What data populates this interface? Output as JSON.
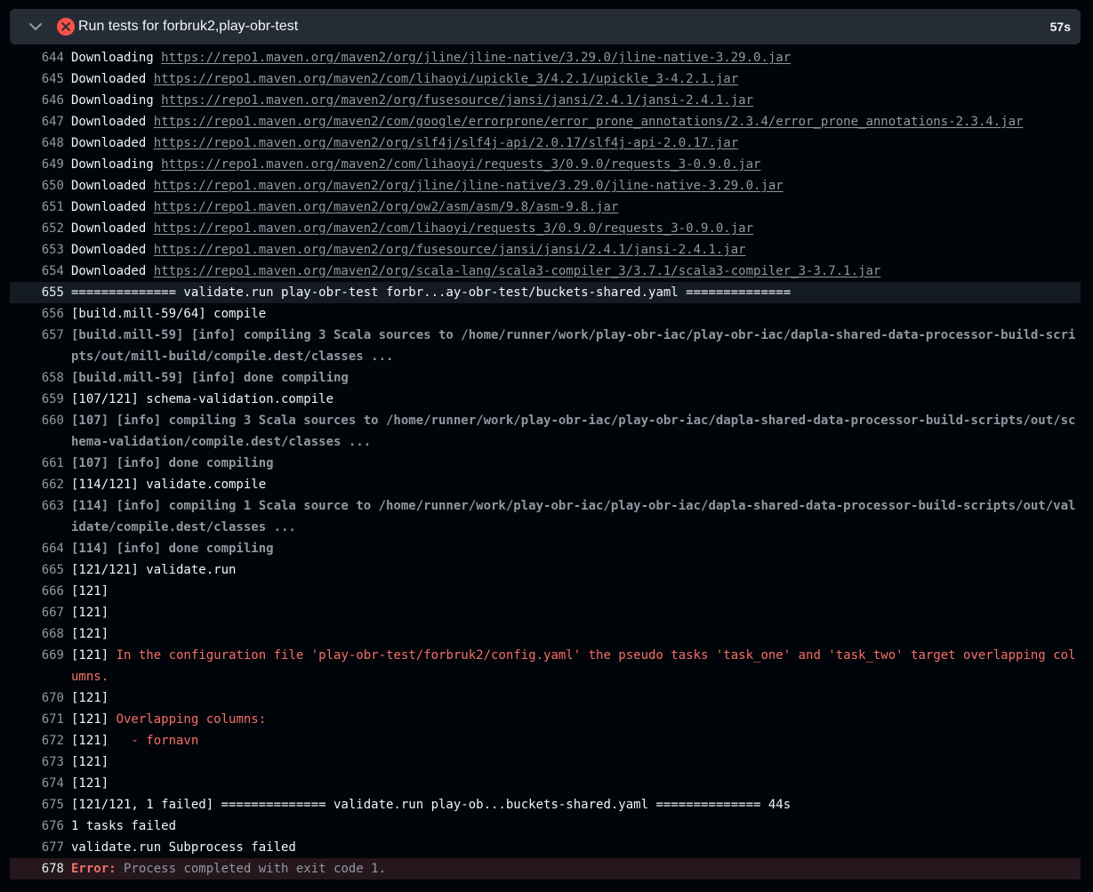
{
  "step": {
    "title": "Run tests for forbruk2,play-obr-test",
    "duration": "57s"
  },
  "colors": {
    "error": "#f85149",
    "header_bg": "#262c36",
    "page_bg": "#010409"
  },
  "icons": {
    "expand": "chevron-down-icon",
    "status": "x-circle-fill-icon"
  },
  "lines": [
    {
      "n": "644",
      "pre": "Downloading ",
      "url": "https://repo1.maven.org/maven2/org/jline/jline-native/3.29.0/jline-native-3.29.0.jar"
    },
    {
      "n": "645",
      "pre": "Downloaded ",
      "url": "https://repo1.maven.org/maven2/com/lihaoyi/upickle_3/4.2.1/upickle_3-4.2.1.jar"
    },
    {
      "n": "646",
      "pre": "Downloading ",
      "url": "https://repo1.maven.org/maven2/org/fusesource/jansi/jansi/2.4.1/jansi-2.4.1.jar"
    },
    {
      "n": "647",
      "pre": "Downloaded ",
      "url": "https://repo1.maven.org/maven2/com/google/errorprone/error_prone_annotations/2.3.4/error_prone_annotations-2.3.4.jar"
    },
    {
      "n": "648",
      "pre": "Downloaded ",
      "url": "https://repo1.maven.org/maven2/org/slf4j/slf4j-api/2.0.17/slf4j-api-2.0.17.jar"
    },
    {
      "n": "649",
      "pre": "Downloading ",
      "url": "https://repo1.maven.org/maven2/com/lihaoyi/requests_3/0.9.0/requests_3-0.9.0.jar"
    },
    {
      "n": "650",
      "pre": "Downloaded ",
      "url": "https://repo1.maven.org/maven2/org/jline/jline-native/3.29.0/jline-native-3.29.0.jar"
    },
    {
      "n": "651",
      "pre": "Downloaded ",
      "url": "https://repo1.maven.org/maven2/org/ow2/asm/asm/9.8/asm-9.8.jar"
    },
    {
      "n": "652",
      "pre": "Downloaded ",
      "url": "https://repo1.maven.org/maven2/com/lihaoyi/requests_3/0.9.0/requests_3-0.9.0.jar"
    },
    {
      "n": "653",
      "pre": "Downloaded ",
      "url": "https://repo1.maven.org/maven2/org/fusesource/jansi/jansi/2.4.1/jansi-2.4.1.jar"
    },
    {
      "n": "654",
      "pre": "Downloaded ",
      "url": "https://repo1.maven.org/maven2/org/scala-lang/scala3-compiler_3/3.7.1/scala3-compiler_3-3.7.1.jar"
    },
    {
      "n": "655",
      "text": "============== validate.run play-obr-test forbr...ay-obr-test/buckets-shared.yaml ==============",
      "style": "hl"
    },
    {
      "n": "656",
      "text": "[build.mill-59/64] compile"
    },
    {
      "n": "657",
      "text": "[build.mill-59] [info] compiling 3 Scala sources to /home/runner/work/play-obr-iac/play-obr-iac/dapla-shared-data-processor-build-scripts/out/mill-build/compile.dest/classes ...",
      "style": "dim"
    },
    {
      "n": "658",
      "text": "[build.mill-59] [info] done compiling",
      "style": "dim"
    },
    {
      "n": "659",
      "text": "[107/121] schema-validation.compile"
    },
    {
      "n": "660",
      "text": "[107] [info] compiling 3 Scala sources to /home/runner/work/play-obr-iac/play-obr-iac/dapla-shared-data-processor-build-scripts/out/schema-validation/compile.dest/classes ...",
      "style": "dim"
    },
    {
      "n": "661",
      "text": "[107] [info] done compiling",
      "style": "dim"
    },
    {
      "n": "662",
      "text": "[114/121] validate.compile"
    },
    {
      "n": "663",
      "text": "[114] [info] compiling 1 Scala source to /home/runner/work/play-obr-iac/play-obr-iac/dapla-shared-data-processor-build-scripts/out/validate/compile.dest/classes ...",
      "style": "dim"
    },
    {
      "n": "664",
      "text": "[114] [info] done compiling",
      "style": "dim"
    },
    {
      "n": "665",
      "text": "[121/121] validate.run"
    },
    {
      "n": "666",
      "text": "[121]"
    },
    {
      "n": "667",
      "text": "[121]"
    },
    {
      "n": "668",
      "text": "[121]"
    },
    {
      "n": "669",
      "pre": "[121] ",
      "red": "In the configuration file 'play-obr-test/forbruk2/config.yaml' the pseudo tasks 'task_one' and 'task_two' target overlapping columns."
    },
    {
      "n": "670",
      "text": "[121]"
    },
    {
      "n": "671",
      "pre": "[121] ",
      "red": "Overlapping columns:"
    },
    {
      "n": "672",
      "pre": "[121] ",
      "red": "  - fornavn"
    },
    {
      "n": "673",
      "text": "[121]"
    },
    {
      "n": "674",
      "text": "[121]"
    },
    {
      "n": "675",
      "text": "[121/121, 1 failed] ============== validate.run play-ob...buckets-shared.yaml ============== 44s"
    },
    {
      "n": "676",
      "text": "1 tasks failed"
    },
    {
      "n": "677",
      "text": "validate.run Subprocess failed"
    },
    {
      "n": "678",
      "errlabel": "Error:",
      "rest": " Process completed with exit code 1.",
      "style": "errline"
    }
  ]
}
